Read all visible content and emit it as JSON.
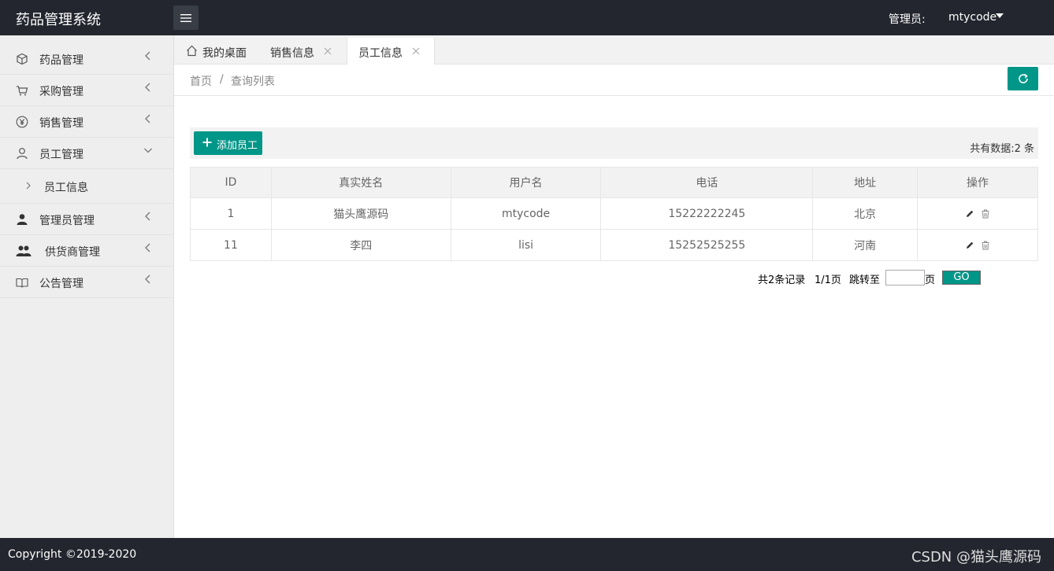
{
  "header": {
    "app_title": "药品管理系统",
    "admin_label": "管理员:",
    "admin_name": "mtycode"
  },
  "sidebar": {
    "items": [
      {
        "label": "药品管理",
        "icon": "cube-icon"
      },
      {
        "label": "采购管理",
        "icon": "cart-icon"
      },
      {
        "label": "销售管理",
        "icon": "yen-icon"
      },
      {
        "label": "员工管理",
        "icon": "user-icon"
      },
      {
        "label": "管理员管理",
        "icon": "admin-user-icon"
      },
      {
        "label": "供货商管理",
        "icon": "users-icon"
      },
      {
        "label": "公告管理",
        "icon": "book-icon"
      }
    ],
    "subitem": {
      "label": "员工信息"
    }
  },
  "tabs": [
    {
      "label": "我的桌面",
      "icon": "home-icon"
    },
    {
      "label": "销售信息"
    },
    {
      "label": "员工信息"
    }
  ],
  "breadcrumb": {
    "home": "首页",
    "separator": "/",
    "current": "查询列表"
  },
  "toolbar": {
    "add_label": "添加员工",
    "total_text": "共有数据:2 条"
  },
  "table": {
    "columns": [
      "ID",
      "真实姓名",
      "用户名",
      "电话",
      "地址",
      "操作"
    ],
    "rows": [
      {
        "id": "1",
        "name": "猫头鹰源码",
        "username": "mtycode",
        "phone": "15222222245",
        "address": "北京"
      },
      {
        "id": "11",
        "name": "李四",
        "username": "lisi",
        "phone": "15252525255",
        "address": "河南"
      }
    ]
  },
  "pager": {
    "records": "共2条记录",
    "pages": "1/1页",
    "jump_label": "跳转至",
    "page_unit": "页",
    "go_label": "GO"
  },
  "footer": {
    "copyright": "Copyright ©2019-2020",
    "watermark": "CSDN @猫头鹰源码"
  },
  "colors": {
    "accent": "#009688",
    "topbar": "#23262e",
    "sidebar": "#eeeeee"
  }
}
